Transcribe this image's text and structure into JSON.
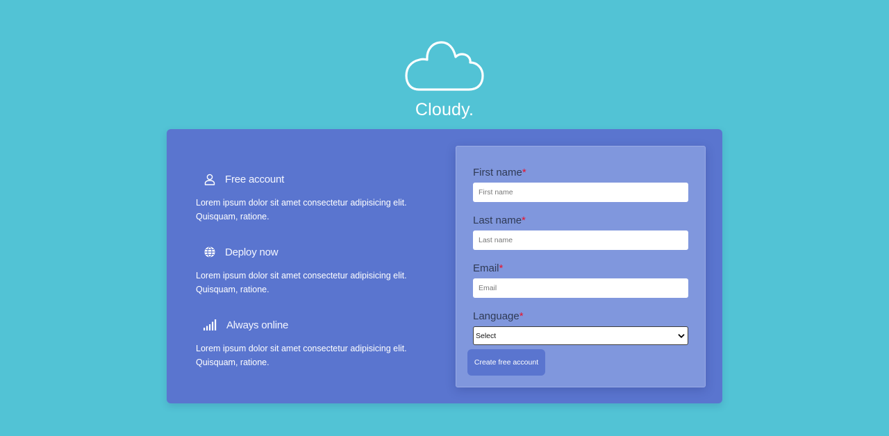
{
  "brand": {
    "name": "Cloudy.",
    "icon": "cloud-icon"
  },
  "features": [
    {
      "icon": "user-icon",
      "title": "Free account",
      "description": "Lorem ipsum dolor sit amet consectetur adipisicing elit. Quisquam, ratione."
    },
    {
      "icon": "globe-icon",
      "title": "Deploy now",
      "description": "Lorem ipsum dolor sit amet consectetur adipisicing elit. Quisquam, ratione."
    },
    {
      "icon": "signal-icon",
      "title": "Always online",
      "description": "Lorem ipsum dolor sit amet consectetur adipisicing elit. Quisquam, ratione."
    }
  ],
  "form": {
    "first_name": {
      "label": "First name",
      "required_mark": "*",
      "placeholder": "First name",
      "value": ""
    },
    "last_name": {
      "label": "Last name",
      "required_mark": "*",
      "placeholder": "Last name",
      "value": ""
    },
    "email": {
      "label": "Email",
      "required_mark": "*",
      "placeholder": "Email",
      "value": ""
    },
    "language": {
      "label": "Language",
      "required_mark": "*",
      "selected": "Select"
    },
    "submit_label": "Create free account"
  },
  "colors": {
    "background": "#52c3d5",
    "card": "#5a75cf",
    "form_panel": "#8097dd",
    "required": "#e8132b"
  }
}
